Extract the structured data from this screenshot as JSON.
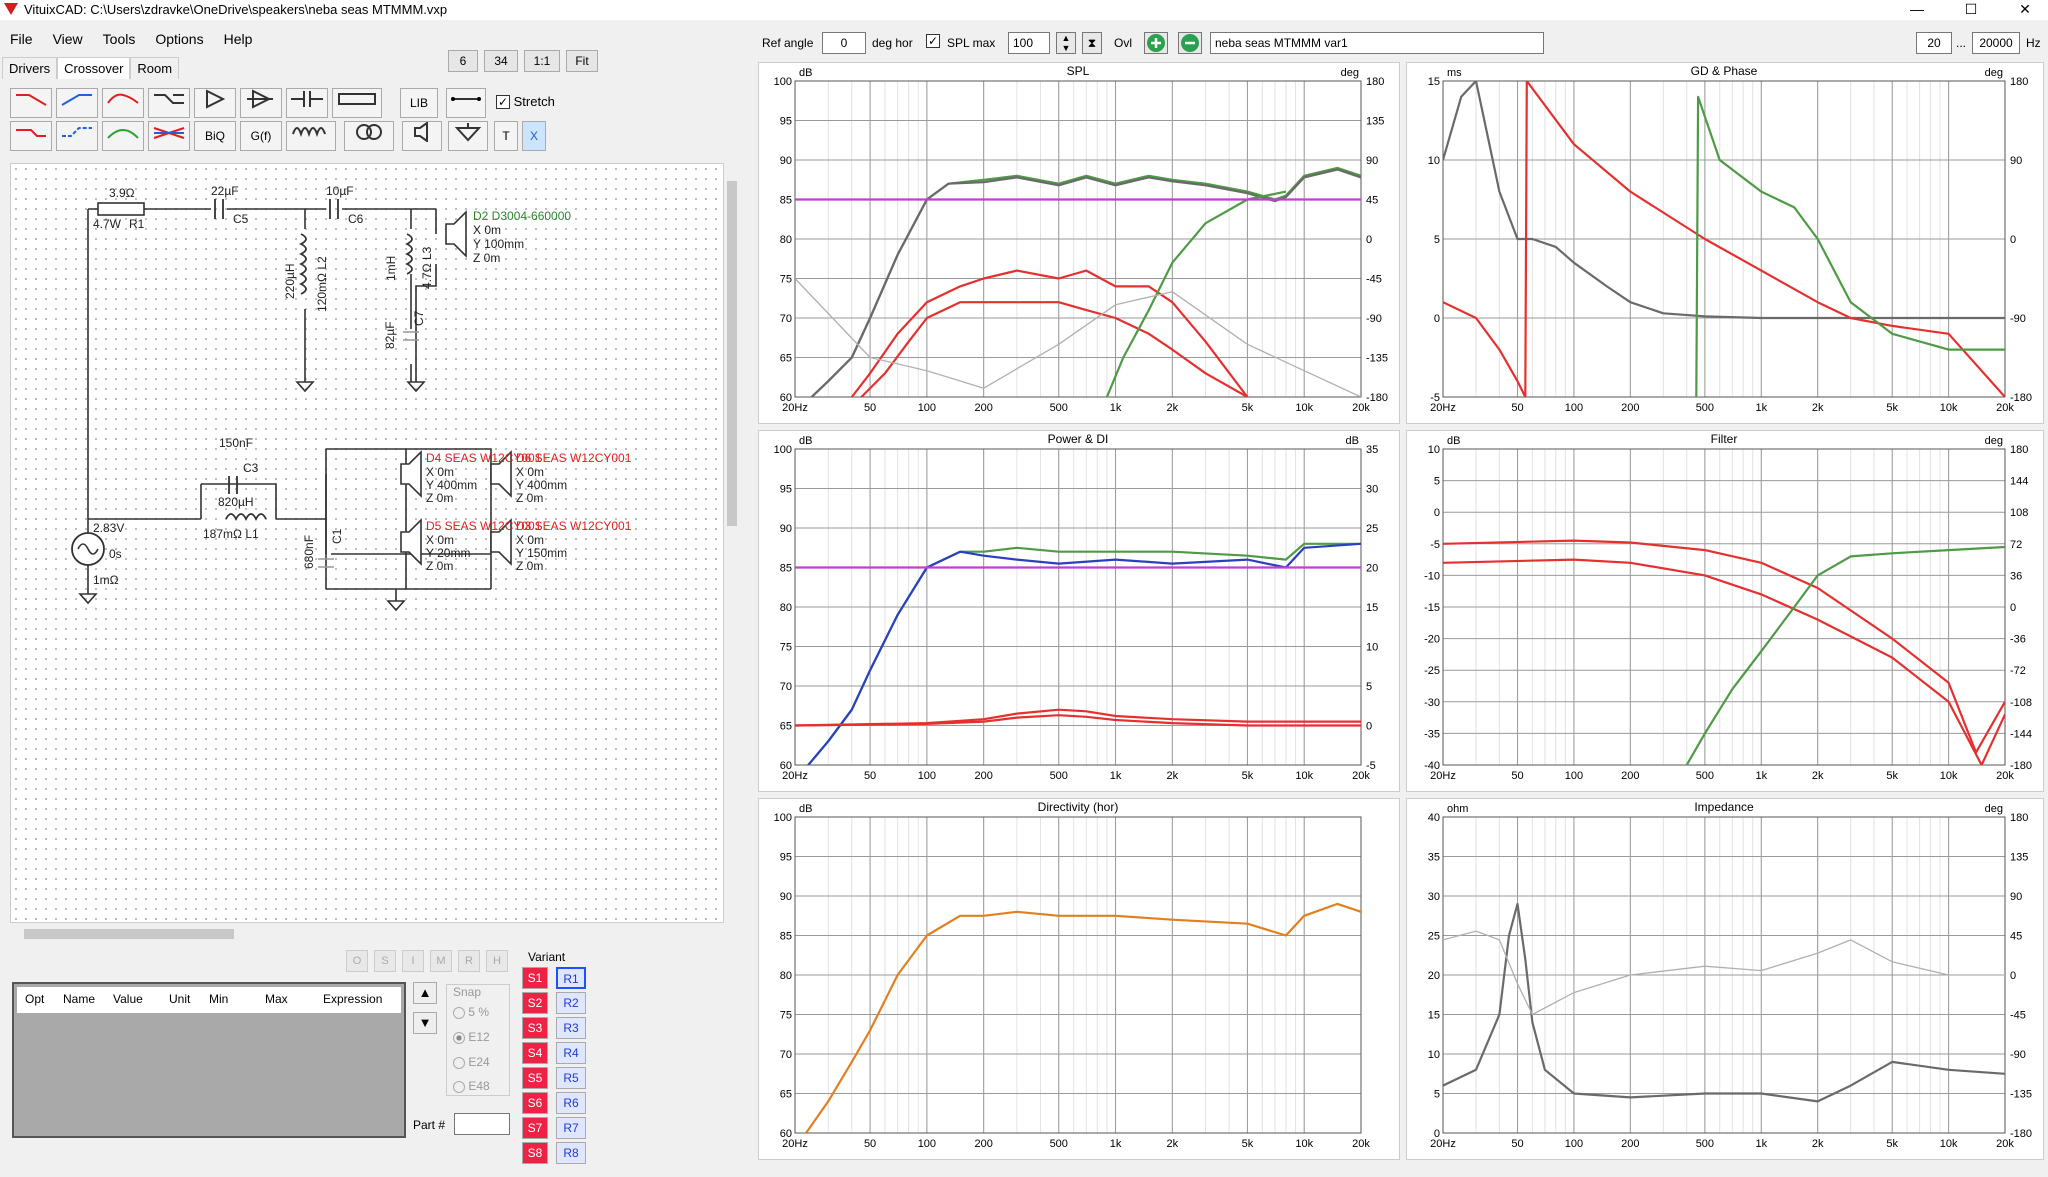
{
  "title": "VituixCAD: C:\\Users\\zdravke\\OneDrive\\speakers\\neba seas MTMMM.vxp",
  "window_controls": {
    "minimize": "—",
    "maximize": "☐",
    "close": "✕"
  },
  "menu": [
    "File",
    "View",
    "Tools",
    "Options",
    "Help"
  ],
  "tabs": [
    "Drivers",
    "Crossover",
    "Room"
  ],
  "zoom_buttons": [
    "6",
    "34",
    "1:1",
    "Fit"
  ],
  "toolbar": {
    "lib": "LIB",
    "stretch": "Stretch",
    "biq": "BiQ",
    "gf": "G(f)",
    "t": "T",
    "x": "X"
  },
  "schematic": {
    "r1": [
      "3.9Ω",
      "4.7W",
      "R1"
    ],
    "c5": [
      "22µF",
      "C5"
    ],
    "c6": [
      "10µF",
      "C6"
    ],
    "l2": [
      "220µH",
      "120mΩ L2"
    ],
    "l3": [
      "1mH",
      "4.7Ω L3"
    ],
    "c7": [
      "82µF",
      "C7"
    ],
    "d2": [
      "D2 D3004-660000",
      "X 0m",
      "Y 100mm",
      "Z 0m"
    ],
    "c3": [
      "150nF",
      "C3"
    ],
    "l1": [
      "820µH",
      "187mΩ L1"
    ],
    "c1": [
      "680nF",
      "C1"
    ],
    "src": [
      "2.83V",
      "0s",
      "1mΩ"
    ],
    "d4": [
      "D4 SEAS W12CY001",
      "X 0m",
      "Y 400mm",
      "Z 0m"
    ],
    "d6": [
      "D6 SEAS W12CY001",
      "X 0m",
      "Y 400mm",
      "Z 0m"
    ],
    "d5": [
      "D5 SEAS W12CY001",
      "X 0m",
      "Y 20mm",
      "Z 0m"
    ],
    "d3": [
      "D3 SEAS W12CY001",
      "X 0m",
      "Y 150mm",
      "Z 0m"
    ]
  },
  "param_buttons": [
    "O",
    "S",
    "I",
    "M",
    "R",
    "H"
  ],
  "table_headers": [
    "Opt",
    "Name",
    "Value",
    "Unit",
    "Min",
    "Max",
    "Expression"
  ],
  "snap": {
    "label": "Snap",
    "options": [
      "5 %",
      "E12",
      "E24",
      "E48"
    ],
    "selected": "E12"
  },
  "part_label": "Part #",
  "variant": {
    "label": "Variant",
    "s": [
      "S1",
      "S2",
      "S3",
      "S4",
      "S5",
      "S6",
      "S7",
      "S8"
    ],
    "r": [
      "R1",
      "R2",
      "R3",
      "R4",
      "R5",
      "R6",
      "R7",
      "R8"
    ],
    "selected": "R1"
  },
  "top": {
    "ref_angle_label": "Ref angle",
    "ref_angle": "0",
    "deg_hor": "deg hor",
    "spl_max_label": "SPL max",
    "spl_max": "100",
    "ovl": "Ovl",
    "variant_name": "neba seas MTMMM var1",
    "fmin": "20",
    "dots": "...",
    "fmax": "20000",
    "hz": "Hz"
  },
  "freq_ticks": [
    "20Hz",
    "50",
    "100",
    "200",
    "500",
    "1k",
    "2k",
    "5k",
    "10k",
    "20k"
  ],
  "colors": {
    "green": "#4e9a45",
    "red": "#e53030",
    "gray": "#6a6a6a",
    "lightgray": "#b0b0b0",
    "magenta": "#c040d0",
    "blue": "#2a40c0",
    "orange": "#e08020",
    "teal": "#30a0a0"
  },
  "charts": [
    {
      "title": "SPL",
      "lunit": "dB",
      "runit": "deg",
      "yl": [
        "100",
        "95",
        "90",
        "85",
        "80",
        "75",
        "70",
        "65",
        "60"
      ],
      "yr": [
        "180",
        "135",
        "90",
        "45",
        "0",
        "-45",
        "-90",
        "-135",
        "-180"
      ],
      "xt": [
        "20Hz",
        "50",
        "100",
        "200",
        "500",
        "1k",
        "2k",
        "5k",
        "10k",
        "20k"
      ]
    },
    {
      "title": "GD & Phase",
      "lunit": "ms",
      "runit": "deg",
      "yl": [
        "15",
        "10",
        "5",
        "0",
        "-5"
      ],
      "yr": [
        "180",
        "90",
        "0",
        "-90",
        "-180"
      ],
      "xt": [
        "20Hz",
        "50",
        "100",
        "200",
        "500",
        "1k",
        "2k",
        "5k",
        "10k",
        "20k"
      ]
    },
    {
      "title": "Power & DI",
      "lunit": "dB",
      "runit": "dB",
      "yl": [
        "100",
        "95",
        "90",
        "85",
        "80",
        "75",
        "70",
        "65",
        "60"
      ],
      "yr": [
        "35",
        "30",
        "25",
        "20",
        "15",
        "10",
        "5",
        "0",
        "-5"
      ],
      "xt": [
        "20Hz",
        "50",
        "100",
        "200",
        "500",
        "1k",
        "2k",
        "5k",
        "10k",
        "20k"
      ]
    },
    {
      "title": "Filter",
      "lunit": "dB",
      "runit": "deg",
      "yl": [
        "10",
        "5",
        "0",
        "-5",
        "-10",
        "-15",
        "-20",
        "-25",
        "-30",
        "-35",
        "-40"
      ],
      "yr": [
        "180",
        "144",
        "108",
        "72",
        "36",
        "0",
        "-36",
        "-72",
        "-108",
        "-144",
        "-180"
      ],
      "xt": [
        "20Hz",
        "50",
        "100",
        "200",
        "500",
        "1k",
        "2k",
        "5k",
        "10k",
        "20k"
      ]
    },
    {
      "title": "Directivity (hor)",
      "lunit": "dB",
      "runit": "",
      "yl": [
        "100",
        "95",
        "90",
        "85",
        "80",
        "75",
        "70",
        "65",
        "60"
      ],
      "yr": [],
      "xt": [
        "20Hz",
        "50",
        "100",
        "200",
        "500",
        "1k",
        "2k",
        "5k",
        "10k",
        "20k"
      ]
    },
    {
      "title": "Impedance",
      "lunit": "ohm",
      "runit": "deg",
      "yl": [
        "40",
        "35",
        "30",
        "25",
        "20",
        "15",
        "10",
        "5",
        "0"
      ],
      "yr": [
        "180",
        "135",
        "90",
        "45",
        "0",
        "-45",
        "-90",
        "-135",
        "-180"
      ],
      "xt": [
        "20Hz",
        "50",
        "100",
        "200",
        "500",
        "1k",
        "2k",
        "5k",
        "10k",
        "20k"
      ]
    }
  ],
  "chart_data": [
    {
      "type": "line",
      "title": "SPL",
      "ylim": [
        60,
        100
      ],
      "y2lim": [
        -180,
        180
      ],
      "xlim": [
        20,
        20000
      ],
      "xscale": "log",
      "grid": true,
      "series": [
        {
          "color": "#4e9a45",
          "axis": "left",
          "x": [
            20,
            30,
            40,
            50,
            70,
            100,
            130,
            200,
            300,
            500,
            700,
            1000,
            1500,
            2000,
            3000,
            5000,
            7000,
            8000,
            10000,
            15000,
            20000
          ],
          "y": [
            58,
            62,
            65,
            70,
            78,
            85,
            87,
            87.5,
            88,
            87,
            88,
            87,
            88,
            87.5,
            87,
            86,
            85,
            85.5,
            88,
            89,
            88
          ]
        },
        {
          "color": "#6a6a6a",
          "axis": "left",
          "x": [
            20,
            30,
            40,
            50,
            70,
            100,
            130,
            200,
            300,
            500,
            700,
            1000,
            1500,
            2000,
            3000,
            5000,
            7000,
            8000,
            10000,
            15000,
            20000
          ],
          "y": [
            58,
            62,
            65,
            70,
            78,
            85,
            87,
            87.2,
            87.8,
            86.8,
            87.8,
            86.8,
            87.8,
            87.3,
            86.8,
            85.8,
            84.8,
            85.3,
            87.8,
            88.8,
            87.8
          ]
        },
        {
          "color": "#e53030",
          "axis": "left",
          "x": [
            40,
            50,
            70,
            100,
            150,
            200,
            300,
            500,
            700,
            1000,
            1500,
            2000,
            3000,
            5000
          ],
          "y": [
            60,
            63,
            68,
            72,
            74,
            75,
            76,
            75,
            76,
            74,
            74,
            72,
            67,
            60
          ]
        },
        {
          "color": "#e53030",
          "axis": "left",
          "x": [
            45,
            60,
            80,
            100,
            150,
            200,
            300,
            500,
            700,
            1000,
            1500,
            2000,
            3000,
            5000,
            6000
          ],
          "y": [
            60,
            63,
            67,
            70,
            72,
            72,
            72,
            72,
            71,
            70,
            68,
            66,
            63,
            60,
            58
          ]
        },
        {
          "color": "#4e9a45",
          "axis": "left",
          "x": [
            900,
            1100,
            1500,
            2000,
            3000,
            5000,
            8000
          ],
          "y": [
            60,
            65,
            71,
            77,
            82,
            85,
            86
          ]
        },
        {
          "color": "#c040d0",
          "axis": "left",
          "x": [
            20,
            20000
          ],
          "y": [
            85,
            85
          ]
        },
        {
          "color": "#b0b0b0",
          "axis": "right",
          "x": [
            20,
            50,
            100,
            200,
            500,
            1000,
            2000,
            5000,
            10000,
            20000
          ],
          "y": [
            -45,
            -135,
            -150,
            -170,
            -120,
            -75,
            -60,
            -120,
            -150,
            -180
          ]
        }
      ]
    },
    {
      "type": "line",
      "title": "GD & Phase",
      "ylim": [
        -5,
        15
      ],
      "y2lim": [
        -180,
        180
      ],
      "xlim": [
        20,
        20000
      ],
      "xscale": "log",
      "grid": true,
      "series": [
        {
          "color": "#6a6a6a",
          "axis": "left",
          "x": [
            20,
            25,
            30,
            40,
            50,
            60,
            80,
            100,
            150,
            200,
            300,
            500,
            1000,
            2000,
            5000,
            20000
          ],
          "y": [
            10,
            14,
            15,
            8,
            5,
            5,
            4.5,
            3.5,
            2,
            1,
            0.3,
            0.1,
            0,
            0,
            0,
            0
          ]
        },
        {
          "color": "#e53030",
          "axis": "left",
          "x": [
            20,
            30,
            40,
            50,
            55,
            56,
            100,
            200,
            500,
            1000,
            2000,
            3000,
            5000,
            10000,
            20000
          ],
          "y": [
            1,
            0,
            -2,
            -4,
            -5,
            15,
            11,
            8,
            5,
            3,
            1,
            0,
            -0.5,
            -1,
            -5
          ]
        },
        {
          "color": "#4e9a45",
          "axis": "left",
          "x": [
            450,
            460,
            600,
            1000,
            1500,
            2000,
            3000,
            5000,
            10000,
            20000
          ],
          "y": [
            -5,
            14,
            10,
            8,
            7,
            5,
            1,
            -1,
            -2,
            -2
          ]
        }
      ]
    },
    {
      "type": "line",
      "title": "Power & DI",
      "ylim": [
        60,
        100
      ],
      "y2lim": [
        -5,
        35
      ],
      "xlim": [
        20,
        20000
      ],
      "xscale": "log",
      "grid": true,
      "series": [
        {
          "color": "#4e9a45",
          "axis": "left",
          "x": [
            20,
            30,
            40,
            50,
            70,
            100,
            150,
            200,
            300,
            500,
            1000,
            2000,
            5000,
            8000,
            10000,
            20000
          ],
          "y": [
            58,
            63,
            67,
            72,
            79,
            85,
            87,
            87,
            87.5,
            87,
            87,
            87,
            86.5,
            86,
            88,
            88
          ]
        },
        {
          "color": "#2a40c0",
          "axis": "left",
          "x": [
            20,
            30,
            40,
            50,
            70,
            100,
            150,
            200,
            300,
            500,
            1000,
            2000,
            5000,
            8000,
            10000,
            20000
          ],
          "y": [
            58,
            63,
            67,
            72,
            79,
            85,
            87,
            86.5,
            86,
            85.5,
            86,
            85.5,
            86,
            85,
            87.5,
            88
          ]
        },
        {
          "color": "#c040d0",
          "axis": "left",
          "x": [
            20,
            20000
          ],
          "y": [
            85,
            85
          ]
        },
        {
          "color": "#e53030",
          "axis": "right",
          "x": [
            20,
            100,
            200,
            300,
            500,
            700,
            1000,
            2000,
            5000,
            20000
          ],
          "y": [
            0,
            0.3,
            0.8,
            1.5,
            2,
            1.8,
            1.2,
            0.8,
            0.5,
            0.5
          ]
        },
        {
          "color": "#e53030",
          "axis": "right",
          "x": [
            20,
            100,
            200,
            300,
            500,
            700,
            1000,
            2000,
            5000,
            20000
          ],
          "y": [
            0,
            0.2,
            0.5,
            1,
            1.3,
            1.1,
            0.7,
            0.3,
            0,
            0
          ]
        }
      ]
    },
    {
      "type": "line",
      "title": "Filter",
      "ylim": [
        -40,
        10
      ],
      "y2lim": [
        -180,
        180
      ],
      "xlim": [
        20,
        20000
      ],
      "xscale": "log",
      "grid": true,
      "series": [
        {
          "color": "#e53030",
          "axis": "left",
          "x": [
            20,
            100,
            200,
            500,
            1000,
            2000,
            5000,
            10000,
            14000,
            20000
          ],
          "y": [
            -5,
            -4.5,
            -4.8,
            -6,
            -8,
            -12,
            -20,
            -27,
            -38,
            -30
          ]
        },
        {
          "color": "#e53030",
          "axis": "left",
          "x": [
            20,
            100,
            200,
            500,
            1000,
            2000,
            5000,
            10000,
            15000,
            20000
          ],
          "y": [
            -8,
            -7.5,
            -8,
            -10,
            -13,
            -17,
            -23,
            -30,
            -40,
            -32
          ]
        },
        {
          "color": "#4e9a45",
          "axis": "left",
          "x": [
            400,
            500,
            700,
            1000,
            1500,
            2000,
            3000,
            5000,
            10000,
            20000
          ],
          "y": [
            -40,
            -35,
            -28,
            -22,
            -15,
            -10,
            -7,
            -6.5,
            -6,
            -5.5
          ]
        }
      ]
    },
    {
      "type": "line",
      "title": "Directivity (hor)",
      "ylim": [
        60,
        100
      ],
      "xlim": [
        20,
        20000
      ],
      "xscale": "log",
      "grid": true,
      "series": [
        {
          "color": "#e08020",
          "axis": "left",
          "x": [
            20,
            30,
            40,
            50,
            70,
            100,
            150,
            200,
            300,
            500,
            1000,
            2000,
            5000,
            8000,
            10000,
            15000,
            20000
          ],
          "y": [
            58,
            64,
            69,
            73,
            80,
            85,
            87.5,
            87.5,
            88,
            87.5,
            87.5,
            87,
            86.5,
            85,
            87.5,
            89,
            88
          ]
        }
      ]
    },
    {
      "type": "line",
      "title": "Impedance",
      "ylim": [
        0,
        40
      ],
      "y2lim": [
        -180,
        180
      ],
      "xlim": [
        20,
        20000
      ],
      "xscale": "log",
      "grid": true,
      "series": [
        {
          "color": "#6a6a6a",
          "axis": "left",
          "x": [
            20,
            30,
            40,
            45,
            50,
            55,
            60,
            70,
            100,
            200,
            500,
            1000,
            2000,
            3000,
            5000,
            10000,
            20000
          ],
          "y": [
            6,
            8,
            15,
            25,
            29,
            22,
            14,
            8,
            5,
            4.5,
            5,
            5,
            4,
            6,
            9,
            8,
            7.5
          ]
        },
        {
          "color": "#b0b0b0",
          "axis": "right",
          "x": [
            20,
            30,
            40,
            50,
            60,
            100,
            200,
            500,
            1000,
            2000,
            3000,
            5000,
            10000,
            20000
          ],
          "y": [
            40,
            50,
            40,
            -10,
            -45,
            -20,
            0,
            10,
            5,
            25,
            40,
            15,
            0,
            0
          ]
        }
      ]
    }
  ]
}
